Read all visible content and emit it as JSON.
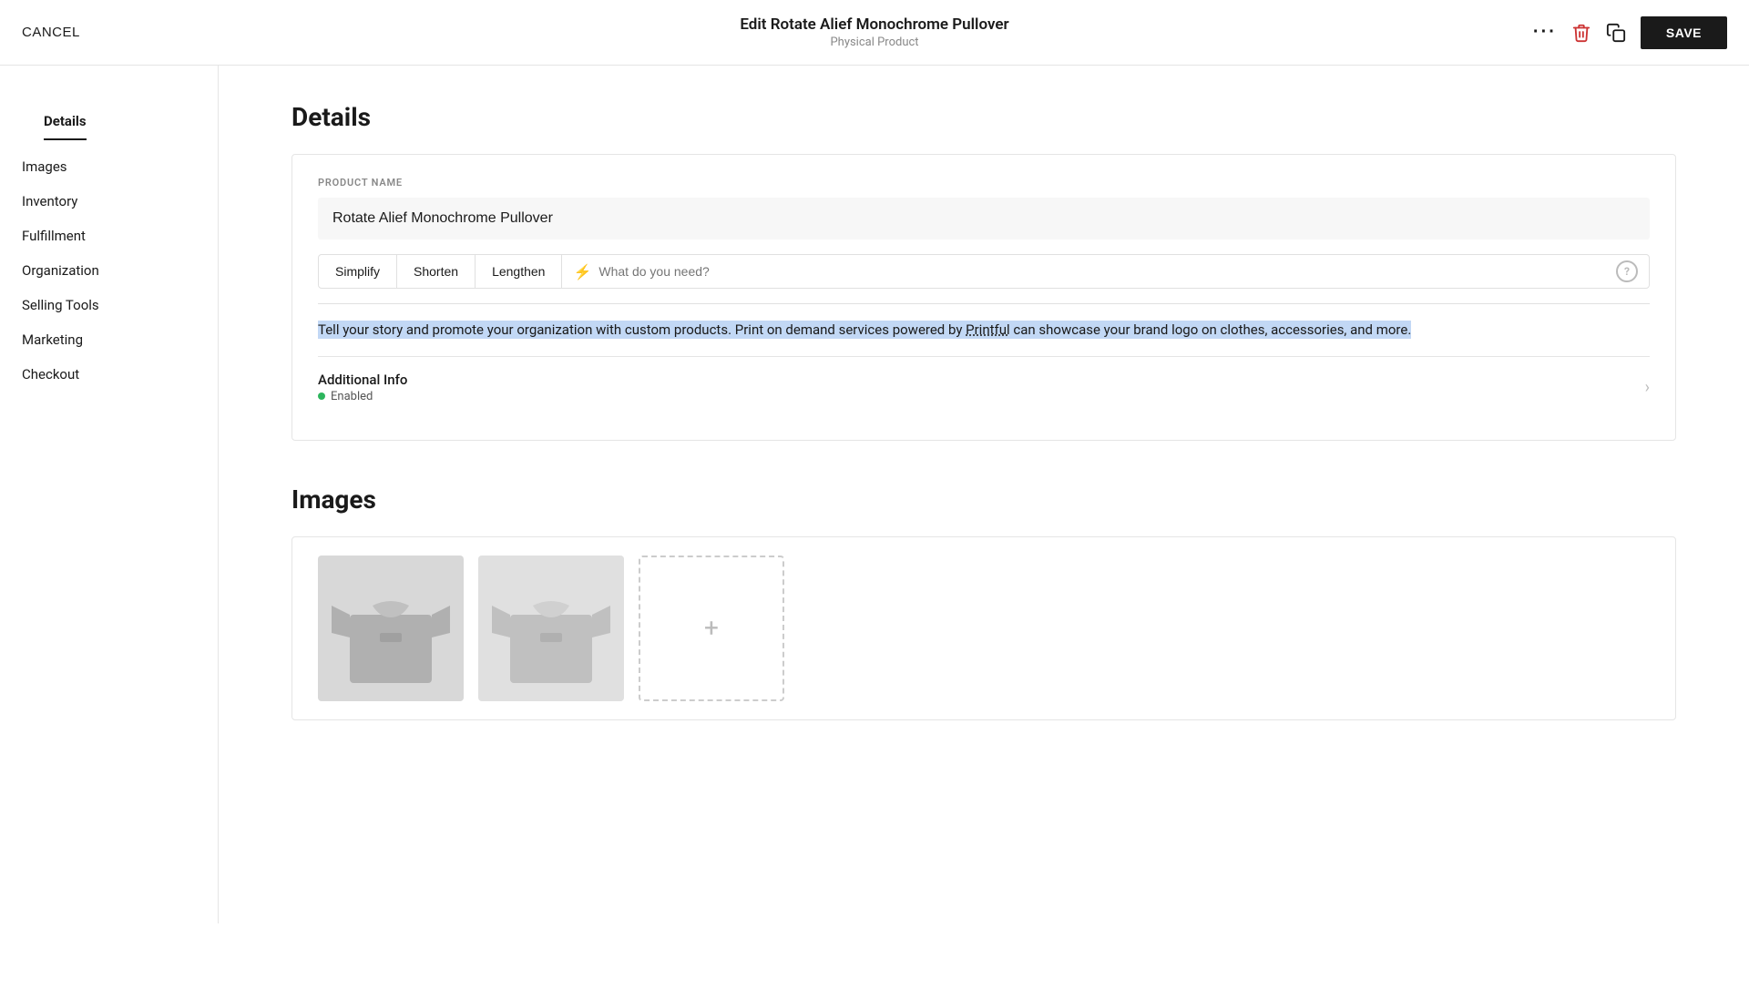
{
  "header": {
    "cancel_label": "CANCEL",
    "title": "Edit Rotate Alief Monochrome Pullover",
    "subtitle": "Physical Product",
    "save_label": "SAVE"
  },
  "sidebar": {
    "items": [
      {
        "id": "details",
        "label": "Details",
        "active": true
      },
      {
        "id": "images",
        "label": "Images",
        "active": false
      },
      {
        "id": "inventory",
        "label": "Inventory",
        "active": false
      },
      {
        "id": "fulfillment",
        "label": "Fulfillment",
        "active": false
      },
      {
        "id": "organization",
        "label": "Organization",
        "active": false
      },
      {
        "id": "selling-tools",
        "label": "Selling Tools",
        "active": false
      },
      {
        "id": "marketing",
        "label": "Marketing",
        "active": false
      },
      {
        "id": "checkout",
        "label": "Checkout",
        "active": false
      }
    ]
  },
  "main": {
    "details_heading": "Details",
    "card": {
      "field_label": "PRODUCT NAME",
      "product_name": "Rotate Alief Monochrome Pullover",
      "ai_toolbar": {
        "simplify_label": "Simplify",
        "shorten_label": "Shorten",
        "lengthen_label": "Lengthen",
        "input_placeholder": "What do you need?"
      },
      "description_before": "Tell your story and promote your organization with custom products. Print on demand services powered by ",
      "description_link": "Printful",
      "description_after": " can showcase your brand logo on clothes, accessories, and more.",
      "additional_info": {
        "label": "Additional Info",
        "status": "Enabled"
      }
    },
    "images_heading": "Images"
  }
}
